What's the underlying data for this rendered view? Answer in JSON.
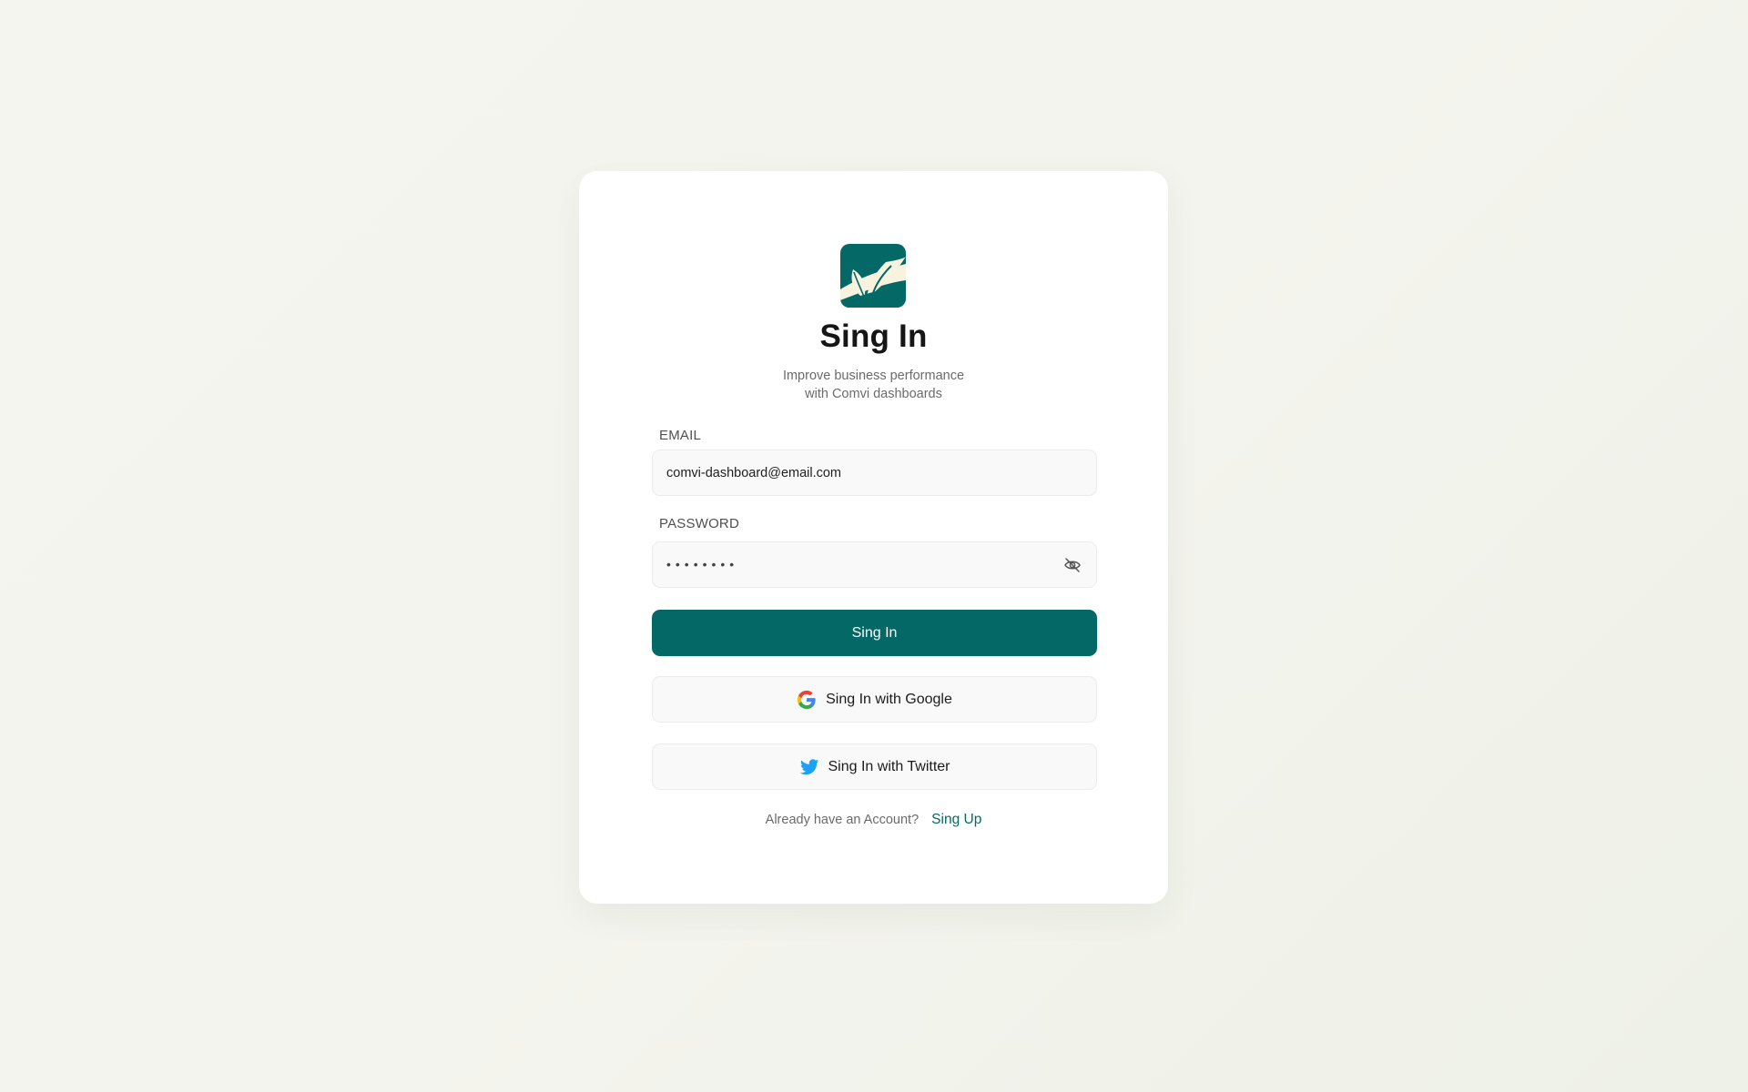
{
  "header": {
    "logo_icon": "leaf-logo-icon",
    "title": "Sing In",
    "subtitle_line1": "Improve business performance",
    "subtitle_line2": "with Comvi dashboards"
  },
  "form": {
    "email_label": "EMAIL",
    "email_value": "comvi-dashboard@email.com",
    "password_label": "PASSWORD",
    "password_mask": "••••••••",
    "password_toggle_icon": "eye-off-icon",
    "submit_label": "Sing In"
  },
  "social": {
    "google_label": "Sing In with Google",
    "google_icon": "google-icon",
    "twitter_label": "Sing In with Twitter",
    "twitter_icon": "twitter-icon"
  },
  "footer": {
    "prompt": "Already have an Account?",
    "link_label": "Sing Up"
  },
  "colors": {
    "brand": "#046867",
    "accent_leaf": "#f7f3de",
    "twitter": "#1da1f2"
  }
}
